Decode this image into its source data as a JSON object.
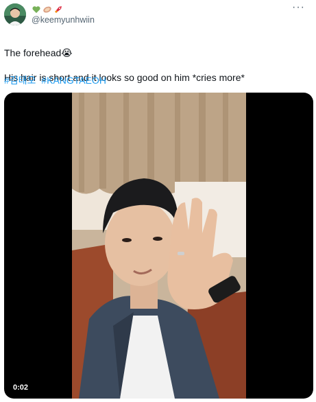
{
  "user": {
    "handle": "@keemyunhwiin",
    "name_emojis": [
      "green-heart-emoji",
      "bread-emoji",
      "rocket-emoji"
    ]
  },
  "tweet": {
    "line1": "The forehead😭",
    "line2": "His hair is short and it looks so good on him *cries more*",
    "hashtags": [
      "#김태오",
      "#KANGTAEOH"
    ]
  },
  "video": {
    "duration": "0:02"
  },
  "colors": {
    "link": "#1d9bf0",
    "muted": "#536471",
    "text": "#0f1419"
  }
}
